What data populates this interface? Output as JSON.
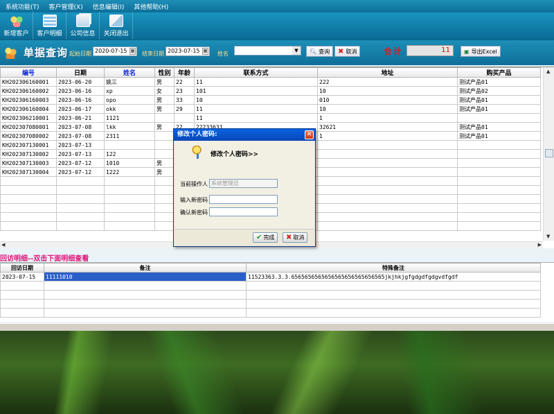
{
  "menu": [
    "系统功能(T)",
    "客户管理(X)",
    "信息编辑(I)",
    "其他帮助(H)"
  ],
  "toolbar": [
    {
      "label": "新增客户",
      "icon": "people-add-icon"
    },
    {
      "label": "客户明细",
      "icon": "list-icon"
    },
    {
      "label": "公司信息",
      "icon": "company-icon"
    },
    {
      "label": "关闭退出",
      "icon": "exit-icon"
    }
  ],
  "query": {
    "title": "单据查询",
    "start_label": "起始日期",
    "start_date": "2020-07-15",
    "end_label": "结束日期",
    "end_date": "2023-07-15",
    "name_label": "姓名",
    "name_value": "",
    "search_label": "查询",
    "cancel_label": "取消",
    "sum_label": "合计",
    "sum_value": "11",
    "export_label": "导出Excel"
  },
  "grid1": {
    "columns": [
      "编号",
      "日期",
      "姓名",
      "性别",
      "年龄",
      "联系方式",
      "地址",
      "购买产品"
    ],
    "rows": [
      [
        "KH202306160001",
        "2023-06-20",
        "姚三",
        "男",
        "22",
        "11",
        "222",
        "测试产品01"
      ],
      [
        "KH202306160002",
        "2023-06-16",
        "xp",
        "女",
        "23",
        "101",
        "10",
        "测试产品02"
      ],
      [
        "KH202306160003",
        "2023-06-16",
        "opo",
        "男",
        "33",
        "10",
        "010",
        "测试产品01"
      ],
      [
        "KH202306160004",
        "2023-06-17",
        "okk",
        "男",
        "29",
        "11",
        "10",
        "测试产品01"
      ],
      [
        "KH202306210001",
        "2023-06-21",
        "1121",
        "",
        "",
        "11",
        "1",
        ""
      ],
      [
        "KH202307080001",
        "2023-07-08",
        "lkk",
        "男",
        "22",
        "22233631",
        "32621",
        "测试产品01"
      ],
      [
        "KH202307080002",
        "2023-07-08",
        "2311",
        "",
        "",
        "",
        "1",
        "测试产品01"
      ],
      [
        "KH202307130001",
        "2023-07-13",
        "",
        "",
        "",
        "",
        "",
        ""
      ],
      [
        "KH202307130002",
        "2023-07-13",
        "122",
        "",
        "",
        "",
        "",
        ""
      ],
      [
        "KH202307130003",
        "2023-07-12",
        "1010",
        "男",
        "",
        "",
        "",
        ""
      ],
      [
        "KH202307130004",
        "2023-07-12",
        "1222",
        "男",
        "",
        "",
        "",
        ""
      ]
    ]
  },
  "detail": {
    "label": "回访明细--双击下面明细查看",
    "columns": [
      "回访日期",
      "备注",
      "特殊备注"
    ],
    "rows": [
      [
        "2023-07-15",
        "11111010",
        "11523363.3.3.6565656565656565656565656565jkjhkjgfgdgdfgdgvdfgdf"
      ]
    ]
  },
  "dialog": {
    "title": "修改个人密码:",
    "heading": "修改个人密码>>",
    "operator_label": "当前操作人",
    "operator_value": "系统管理员",
    "new_label": "输入新密码",
    "new_value": "",
    "confirm_label": "确认新密码",
    "confirm_value": "",
    "ok_label": "完成",
    "cancel_label": "取消"
  }
}
